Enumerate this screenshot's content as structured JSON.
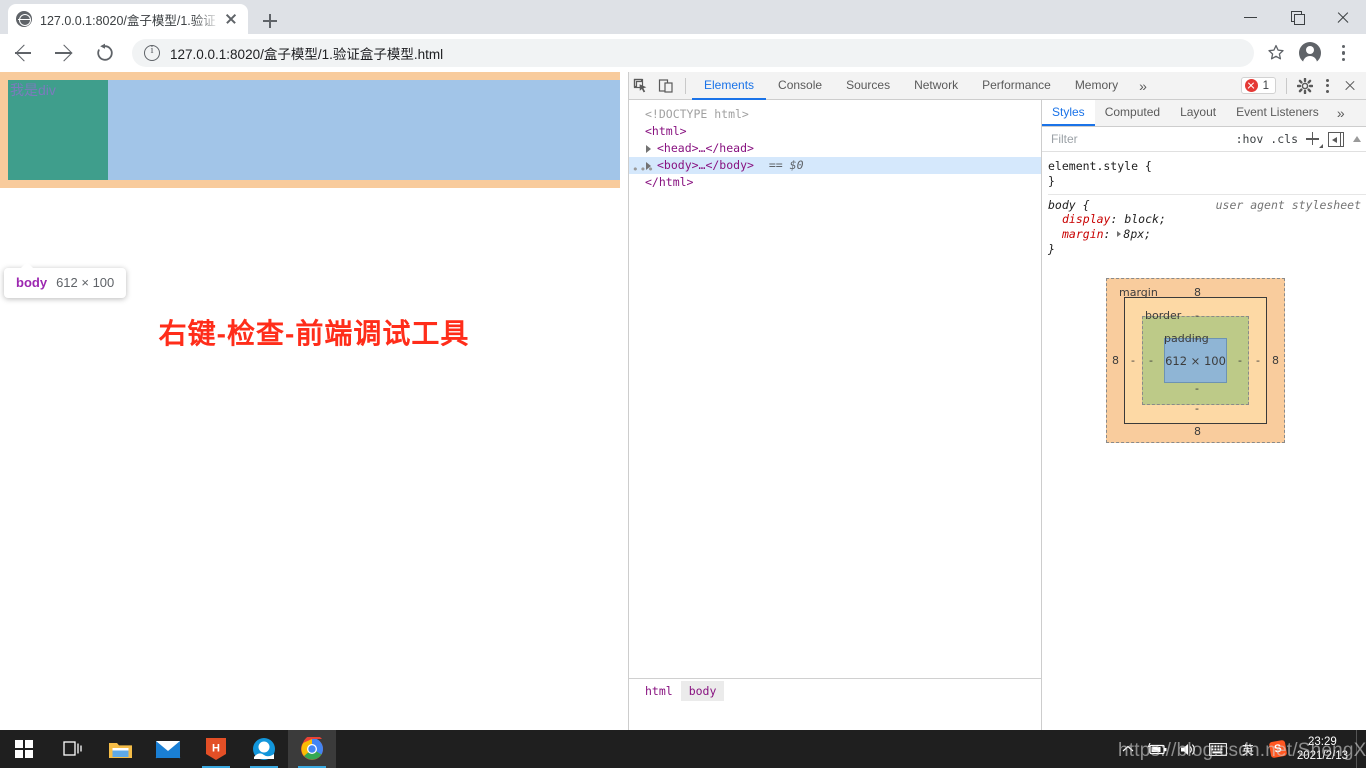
{
  "browser": {
    "tab": {
      "title": "127.0.0.1:8020/盒子模型/1.验证",
      "favicon": "globe-icon",
      "close": "×"
    },
    "new_tab_label": "+",
    "window_controls": {
      "minimize": "—",
      "maximize": "▢",
      "close": "✕"
    },
    "toolbar": {
      "back": "←",
      "forward": "→",
      "reload": "⟳",
      "site_info": "ⓘ",
      "url": "127.0.0.1:8020/盒子模型/1.验证盒子模型.html",
      "bookmark": "☆",
      "profile": "avatar-icon",
      "menu": "⋮"
    }
  },
  "page": {
    "div_text": "我是div",
    "heading": "右键-检查-前端调试工具",
    "highlight_badge": {
      "tag": "body",
      "dimensions": "612 × 100"
    }
  },
  "devtools": {
    "tools": {
      "inspect": "inspect-element-icon",
      "device": "device-toolbar-icon"
    },
    "tabs": [
      {
        "label": "Elements",
        "active": true
      },
      {
        "label": "Console",
        "active": false
      },
      {
        "label": "Sources",
        "active": false
      },
      {
        "label": "Network",
        "active": false
      },
      {
        "label": "Performance",
        "active": false
      },
      {
        "label": "Memory",
        "active": false
      }
    ],
    "tabs_overflow": "»",
    "errors": {
      "count": "1"
    },
    "settings": "gear-icon",
    "menu": "⋮",
    "close": "✕",
    "dom": {
      "lines": [
        {
          "text": "<!DOCTYPE html>",
          "kind": "doctype"
        },
        {
          "text": "<html>",
          "kind": "tag"
        },
        {
          "text": "<head>…</head>",
          "kind": "collapsed"
        },
        {
          "text": "<body>…</body>",
          "kind": "collapsed-selected",
          "suffix": "== $0"
        },
        {
          "text": "</html>",
          "kind": "tag"
        }
      ]
    },
    "breadcrumb": [
      {
        "label": "html",
        "active": false
      },
      {
        "label": "body",
        "active": true
      }
    ],
    "sidebar": {
      "tabs": [
        {
          "label": "Styles",
          "active": true
        },
        {
          "label": "Computed",
          "active": false
        },
        {
          "label": "Layout",
          "active": false
        },
        {
          "label": "Event Listeners",
          "active": false
        }
      ],
      "tabs_overflow": "»",
      "filter_placeholder": "Filter",
      "toggles": {
        "hov": ":hov",
        "cls": ".cls",
        "new_rule": "+",
        "sidebar_toggle": "◀|"
      },
      "rules": [
        {
          "selector": "element.style {",
          "origin": "",
          "declarations": [],
          "close": "}"
        },
        {
          "selector": "body {",
          "origin": "user agent stylesheet",
          "declarations": [
            {
              "property": "display",
              "value": "block;"
            },
            {
              "property": "margin",
              "value": "8px;",
              "expandable": true
            }
          ],
          "close": "}"
        }
      ],
      "box_model": {
        "margin_label": "margin",
        "border_label": "border",
        "padding_label": "padding",
        "content": "612 × 100",
        "margin_values": {
          "top": "8",
          "right": "8",
          "bottom": "8",
          "left": "8"
        },
        "border_values": {
          "top": "-",
          "right": "-",
          "bottom": "-",
          "left": "-"
        },
        "padding_values": {
          "top": "-",
          "right": "-",
          "bottom": "-",
          "left": "-"
        },
        "colors": {
          "margin": "#f9cc9d",
          "border": "#fdd9a5",
          "padding": "#bdca88",
          "content": "#8fb5d5"
        }
      }
    }
  },
  "taskbar": {
    "items": [
      {
        "name": "start",
        "label": ""
      },
      {
        "name": "task-view",
        "label": ""
      },
      {
        "name": "file-explorer",
        "label": ""
      },
      {
        "name": "mail",
        "label": ""
      },
      {
        "name": "hbuilder",
        "label": "H"
      },
      {
        "name": "qq-browser",
        "label": ""
      },
      {
        "name": "chrome",
        "label": ""
      }
    ],
    "tray": {
      "chevron": "^",
      "battery": "battery-icon",
      "volume": "volume-icon",
      "ime": "英",
      "keyboard": "keyboard-icon",
      "sogou": "S"
    },
    "clock": {
      "time": "23:29",
      "date": "2021/2/13"
    }
  },
  "watermark": {
    "text": "https://blog.csdn.net/ShengXIABai"
  }
}
